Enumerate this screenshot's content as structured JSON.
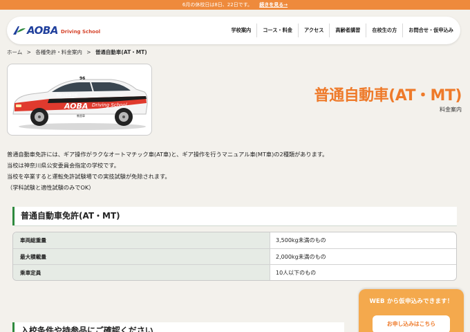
{
  "announcement": {
    "text": "6月の休校日は8日、22日です。",
    "link_label": "続きを見る→"
  },
  "header": {
    "logo_text": "AOBA",
    "logo_sub": "Driving School",
    "nav": [
      "学校案内",
      "コース・料金",
      "アクセス",
      "高齢者講習",
      "在校生の方",
      "お問合せ・仮申込み"
    ]
  },
  "breadcrumb": {
    "home": "ホーム",
    "sep": ">",
    "parent": "各種免許・料金案内",
    "current": "普通自動車(AT・MT)"
  },
  "hero": {
    "title": "普通自動車(AT・MT)",
    "subtitle": "料金案内",
    "car_logo": "AOBA",
    "car_logo_sub": "Driving School",
    "car_number": "96",
    "car_door_text": "青葉自動車学校",
    "car_small_text": "教習車"
  },
  "intro": {
    "lines": [
      "普通自動車免許には、ギア操作がラクなオートマチック車(AT車)と、ギア操作を行うマニュアル車(MT車)の2種類があります。",
      "当校は神奈川県公安委員会指定の学校です。",
      "当校を卒業すると運転免許試験場での実技試験が免除されます。",
      "（学科試験と適性試験のみでOK）"
    ]
  },
  "section": {
    "title": "普通自動車免許(AT・MT)",
    "rows": [
      {
        "key": "車両総重量",
        "value": "3,500kg未満のもの"
      },
      {
        "key": "最大積載量",
        "value": "2,000kg未満のもの"
      },
      {
        "key": "乗車定員",
        "value": "10人以下のもの"
      }
    ]
  },
  "next_section": {
    "title": "入校条件や持参品にご確認ください"
  },
  "web_panel": {
    "title": "WEB から仮申込みできます！",
    "button_label": "お申し込みはこちら"
  },
  "colors": {
    "accent": "#ee7a2a",
    "topbar": "#ee8a3c",
    "brand_blue": "#1f3f9c",
    "section_green": "#2e8a3e",
    "panel_orange": "#f4a94d"
  }
}
